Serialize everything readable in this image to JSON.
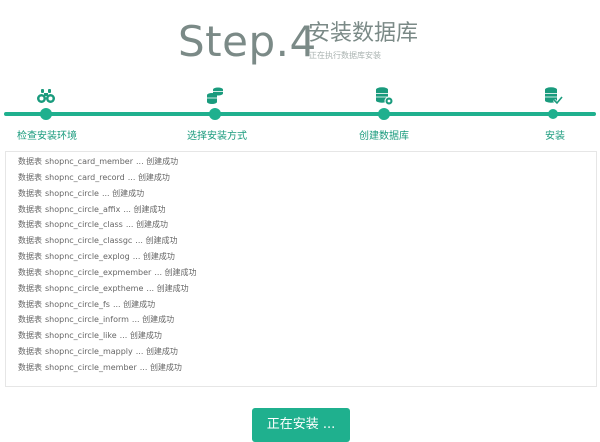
{
  "header": {
    "step_title": "Step.4",
    "step_name": "安装数据库",
    "step_sub": "正在执行数据库安装"
  },
  "stages": [
    {
      "label": "检查安装环境",
      "icon": "binoculars-icon"
    },
    {
      "label": "选择安装方式",
      "icon": "database-coins-icon"
    },
    {
      "label": "创建数据库",
      "icon": "database-settings-icon"
    },
    {
      "label": "安装",
      "icon": "database-check-icon"
    }
  ],
  "log": {
    "prefix": "数据表",
    "suffix": "... 创建成功",
    "tables": [
      "shopnc_card_member",
      "shopnc_card_record",
      "shopnc_circle",
      "shopnc_circle_affix",
      "shopnc_circle_class",
      "shopnc_circle_classgc",
      "shopnc_circle_explog",
      "shopnc_circle_expmember",
      "shopnc_circle_exptheme",
      "shopnc_circle_fs",
      "shopnc_circle_inform",
      "shopnc_circle_like",
      "shopnc_circle_mapply",
      "shopnc_circle_member"
    ]
  },
  "button": {
    "label": "正在安装 ..."
  },
  "colors": {
    "accent": "#1fb08e",
    "title": "#7b8a87",
    "label": "#1a9b7d"
  }
}
